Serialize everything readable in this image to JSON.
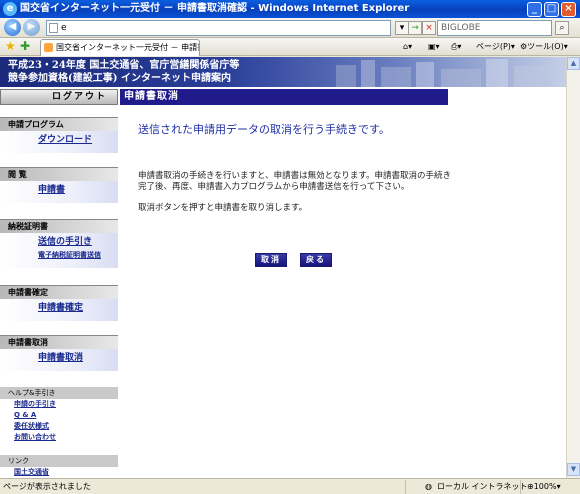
{
  "window": {
    "title": "国交省インターネット一元受付 － 申請書取消確認 - Windows Internet Explorer"
  },
  "address_bar": {
    "url": "e",
    "search_placeholder": "BIGLOBE",
    "go_label": "→",
    "stop_label": "×"
  },
  "tabs": [
    {
      "label": "国交省インターネット一元受付 － 申請書取消確認"
    }
  ],
  "toolbar": {
    "page_label": "ページ(P)",
    "tools_label": "ツール(O)"
  },
  "banner": {
    "line1": "平成23・24年度 国土交通省、官庁営繕関係省庁等",
    "line2": "競争参加資格(建設工事) インターネット申請案内"
  },
  "nav": {
    "logout_label": "ログアウト",
    "sections": [
      {
        "head": "申請プログラム",
        "links": [
          "ダウンロード"
        ]
      },
      {
        "head": "閲 覧",
        "links": [
          "申請書"
        ]
      },
      {
        "head": "納税証明書",
        "links": [
          "送信の手引き",
          "電子納税証明書送信"
        ]
      },
      {
        "head": "申請書確定",
        "links": [
          "申請書確定"
        ]
      },
      {
        "head": "申請書取消",
        "links": [
          "申請書取消"
        ]
      }
    ],
    "help": {
      "head": "ヘルプ&手引き",
      "links": [
        "申請の手引き",
        "Q & A",
        "委任状様式",
        "お問い合わせ"
      ]
    },
    "links_box": {
      "head": "リンク",
      "links": [
        "国土交通省"
      ]
    }
  },
  "main": {
    "header": "申請書取消",
    "title": "送信された申請用データの取消を行う手続きです。",
    "para1": "申請書取消の手続きを行いますと、申請書は無効となります。申請書取消の手続き完了後、再度、申請書入力プログラムから申請書送信を行って下さい。",
    "para2": "取消ボタンを押すと申請書を取り消します。",
    "cancel_button": "取消",
    "back_button": "戻る"
  },
  "status": {
    "left": "ページが表示されました",
    "zone": "ローカル イントラネット",
    "zoom": "100%"
  }
}
